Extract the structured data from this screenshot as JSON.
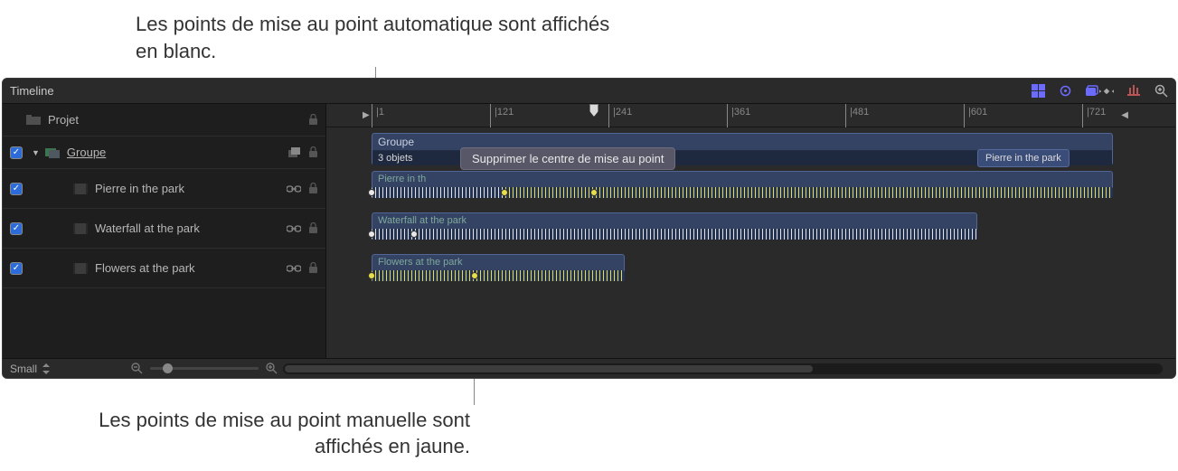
{
  "annotations": {
    "top": "Les points de mise au point automatique sont affichés en blanc.",
    "bottom": "Les points de mise au point manuelle sont affichés en jaune."
  },
  "header": {
    "title": "Timeline"
  },
  "sidebar": {
    "project": "Projet",
    "group": "Groupe",
    "items": [
      {
        "label": "Pierre in the park"
      },
      {
        "label": "Waterfall at the park"
      },
      {
        "label": "Flowers at the park"
      }
    ]
  },
  "timeline": {
    "ruler_ticks": [
      "|1",
      "|121",
      "|241",
      "|361",
      "|481",
      "|601",
      "|721"
    ],
    "group_label": "Groupe",
    "subinfo": "3 objets",
    "pill_label": "Pierre in the park",
    "clips": [
      {
        "label": "Pierre in th"
      },
      {
        "label": "Waterfall at the park"
      },
      {
        "label": "Flowers at the park"
      }
    ],
    "tooltip": "Supprimer le centre de mise au point"
  },
  "footer": {
    "size_label": "Small"
  },
  "colors": {
    "accent": "#2d6cd8",
    "clip_bg": "#344264",
    "auto_point": "#e8e8e8",
    "manual_point": "#e6de4a"
  }
}
